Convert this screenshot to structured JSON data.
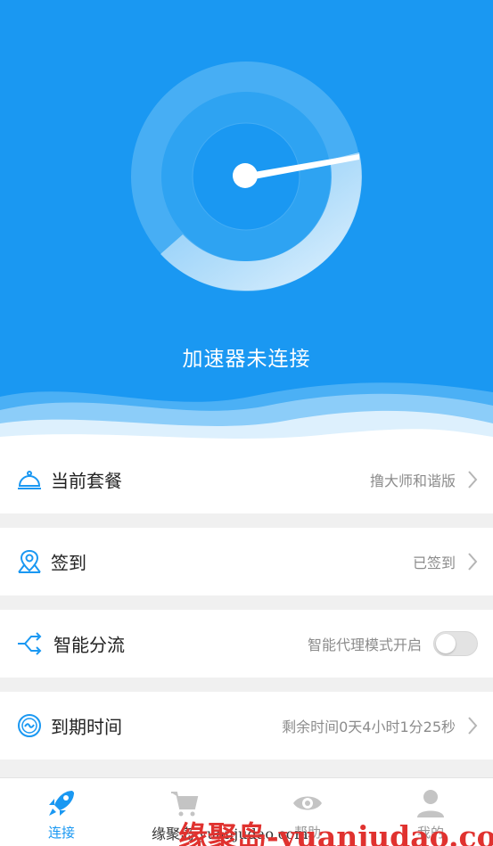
{
  "hero": {
    "status_text": "加速器未连接",
    "background_color": "#1a98f2"
  },
  "rows": [
    {
      "icon": "bell-icon",
      "title": "当前套餐",
      "value": "撸大师和谐版",
      "trailing": "chevron"
    },
    {
      "icon": "map-pin-icon",
      "title": "签到",
      "value": "已签到",
      "trailing": "chevron"
    },
    {
      "icon": "split-arrows-icon",
      "title": "智能分流",
      "value": "智能代理模式开启",
      "trailing": "toggle",
      "toggle_on": false
    },
    {
      "icon": "timer-icon",
      "title": "到期时间",
      "value": "剩余时间0天4小时1分25秒",
      "trailing": "chevron"
    }
  ],
  "tabs": [
    {
      "icon": "rocket-icon",
      "label": "连接",
      "active": true
    },
    {
      "icon": "cart-icon",
      "label": "",
      "active": false
    },
    {
      "icon": "eye-icon",
      "label": "帮助",
      "active": false
    },
    {
      "icon": "user-icon",
      "label": "我的",
      "active": false
    }
  ],
  "watermark": {
    "small_text": "缘聚岛 yuanjudao.com",
    "big_text": "缘聚岛-yuanjudao.com"
  }
}
